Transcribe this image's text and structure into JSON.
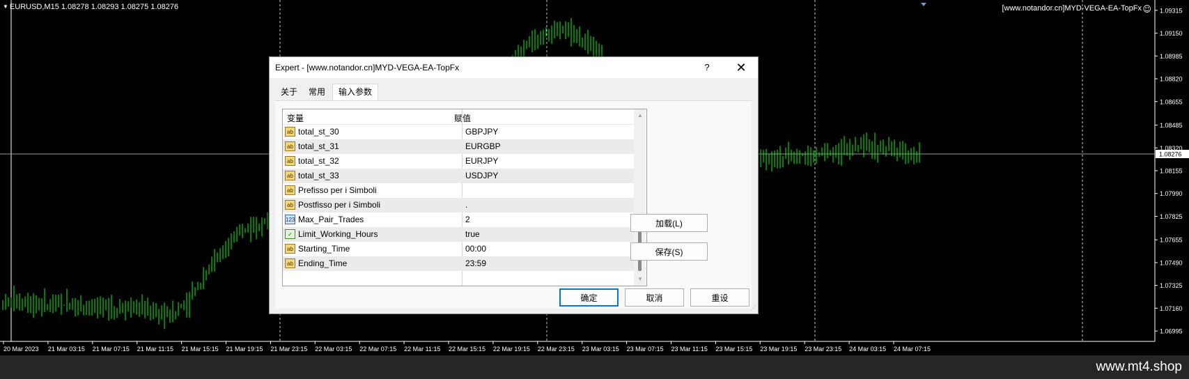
{
  "chart": {
    "header_label": "EURUSD,M15  1.08278 1.08293 1.08275 1.08276",
    "ea_label": "[www.notandor.cn]MYD-VEGA-EA-TopFx",
    "ea_icon": "smiley-face-icon",
    "candle_color": "#00ff00",
    "current_price": "1.08276",
    "y_ticks": [
      "1.09315",
      "1.09150",
      "1.08985",
      "1.08820",
      "1.08655",
      "1.08485",
      "1.08320",
      "1.08155",
      "1.07990",
      "1.07825",
      "1.07655",
      "1.07490",
      "1.07325",
      "1.07160",
      "1.06995"
    ],
    "x_ticks": [
      "20 Mar 2023",
      "21 Mar 03:15",
      "21 Mar 07:15",
      "21 Mar 11:15",
      "21 Mar 15:15",
      "21 Mar 19:15",
      "21 Mar 23:15",
      "22 Mar 03:15",
      "22 Mar 07:15",
      "22 Mar 11:15",
      "22 Mar 15:15",
      "22 Mar 19:15",
      "22 Mar 23:15",
      "23 Mar 03:15",
      "23 Mar 07:15",
      "23 Mar 11:15",
      "23 Mar 15:15",
      "23 Mar 19:15",
      "23 Mar 23:15",
      "24 Mar 03:15",
      "24 Mar 07:15"
    ],
    "price_path": [
      1.072,
      1.0721,
      1.0719,
      1.0718,
      1.0719,
      1.0717,
      1.0716,
      1.0717,
      1.0713,
      1.0711,
      1.0722,
      1.0745,
      1.076,
      1.0774,
      1.078,
      1.0784,
      1.0782,
      1.0778,
      1.0773,
      1.0771,
      1.077,
      1.0773,
      1.0776,
      1.078,
      1.0795,
      1.083,
      1.0862,
      1.089,
      1.0905,
      1.0915,
      1.0918,
      1.091,
      1.09,
      1.087,
      1.0845,
      1.0838,
      1.0836,
      1.0833,
      1.0832,
      1.0831,
      1.0828,
      1.0826,
      1.0825,
      1.0826,
      1.0829,
      1.0831,
      1.0833,
      1.0832,
      1.0829,
      1.0827
    ]
  },
  "dialog": {
    "title": "Expert - [www.notandor.cn]MYD-VEGA-EA-TopFx",
    "help_label": "?",
    "close_label": "✕",
    "tabs": [
      {
        "label": "关于",
        "active": false
      },
      {
        "label": "常用",
        "active": false
      },
      {
        "label": "输入参数",
        "active": true
      }
    ],
    "grid": {
      "col_variable": "变量",
      "col_value": "赋值",
      "rows": [
        {
          "icon": "ab",
          "name": "total_st_30",
          "value": "GBPJPY"
        },
        {
          "icon": "ab",
          "name": "total_st_31",
          "value": "EURGBP"
        },
        {
          "icon": "ab",
          "name": "total_st_32",
          "value": "EURJPY"
        },
        {
          "icon": "ab",
          "name": "total_st_33",
          "value": "USDJPY"
        },
        {
          "icon": "ab",
          "name": "Prefisso per i Simboli",
          "value": ""
        },
        {
          "icon": "ab",
          "name": "Postfisso per i Simboli",
          "value": "."
        },
        {
          "icon": "123",
          "name": "Max_Pair_Trades",
          "value": "2"
        },
        {
          "icon": "bool",
          "name": "Limit_Working_Hours",
          "value": "true"
        },
        {
          "icon": "ab",
          "name": "Starting_Time",
          "value": "00:00"
        },
        {
          "icon": "ab",
          "name": "Ending_Time",
          "value": "23:59"
        }
      ]
    },
    "buttons": {
      "load": "加载(L)",
      "save": "保存(S)",
      "ok": "确定",
      "cancel": "取消",
      "reset": "重设"
    }
  },
  "watermark": "www.mt4.shop"
}
